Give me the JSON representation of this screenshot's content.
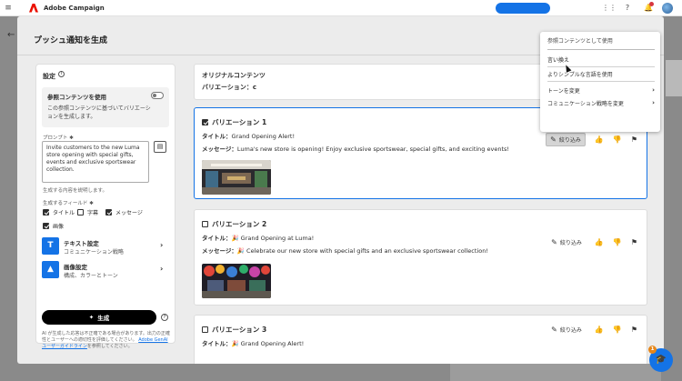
{
  "app": {
    "name": "Adobe Campaign"
  },
  "dialog": {
    "title": "プッシュ通知を生成"
  },
  "settings": {
    "title": "設定",
    "reference": {
      "title": "参照コンテンツを使用",
      "description": "この参照コンテンツに基づいてバリエーションを生成します。"
    },
    "prompt_label": "プロンプト ✱",
    "prompt_value": "Invite customers to the new Luma store opening with special gifts, events and exclusive sportswear collection.",
    "prompt_help": "生成する内容を説明します。",
    "fields_label": "生成するフィールド ✱",
    "fields": [
      {
        "label": "タイトル",
        "checked": true
      },
      {
        "label": "字幕",
        "checked": false
      },
      {
        "label": "メッセージ",
        "checked": true
      },
      {
        "label": "画像",
        "checked": true
      }
    ],
    "text_settings": {
      "title": "テキスト設定",
      "subtitle": "コミュニケーション戦略"
    },
    "image_settings": {
      "title": "画像設定",
      "subtitle": "構成、カラーとトーン"
    },
    "generate_label": "生成",
    "disclaimer_text": "AI が生成した応答は不正確である場合があります。出力の正確性とユーザーへの適切性を評価してください。",
    "disclaimer_link": "Adobe GenAI ユーザーガイドライン",
    "disclaimer_tail": "を参照してください。"
  },
  "original": {
    "title": "オリジナルコンテンツ",
    "variation": "バリエーション：c"
  },
  "variations": [
    {
      "title": "バリエーション 1",
      "checked": true,
      "title_label": "タイトル：",
      "title_value": "Grand Opening Alert!",
      "message_label": "メッセージ：",
      "message_value": "Luma's new store is opening! Enjoy exclusive sportswear, special gifts, and exciting events!",
      "refine_label": "絞り込み"
    },
    {
      "title": "バリエーション 2",
      "checked": false,
      "title_label": "タイトル：",
      "title_value": "🎉 Grand Opening at Luma!",
      "message_label": "メッセージ：",
      "message_value": "🎉 Celebrate our new store with special gifts and an exclusive sportswear collection!",
      "refine_label": "絞り込み"
    },
    {
      "title": "バリエーション 3",
      "checked": false,
      "title_label": "タイトル：",
      "title_value": "🎉 Grand Opening Alert!",
      "refine_label": "絞り込み"
    }
  ],
  "menu": {
    "header": "参照コンテンツとして使用",
    "items": [
      {
        "label": "言い換え",
        "submenu": false
      },
      {
        "label": "よりシンプルな言語を使用",
        "submenu": false
      },
      {
        "label": "トーンを変更",
        "submenu": true
      },
      {
        "label": "コミュニケーション戦略を変更",
        "submenu": true
      }
    ]
  },
  "help_badge": "1"
}
